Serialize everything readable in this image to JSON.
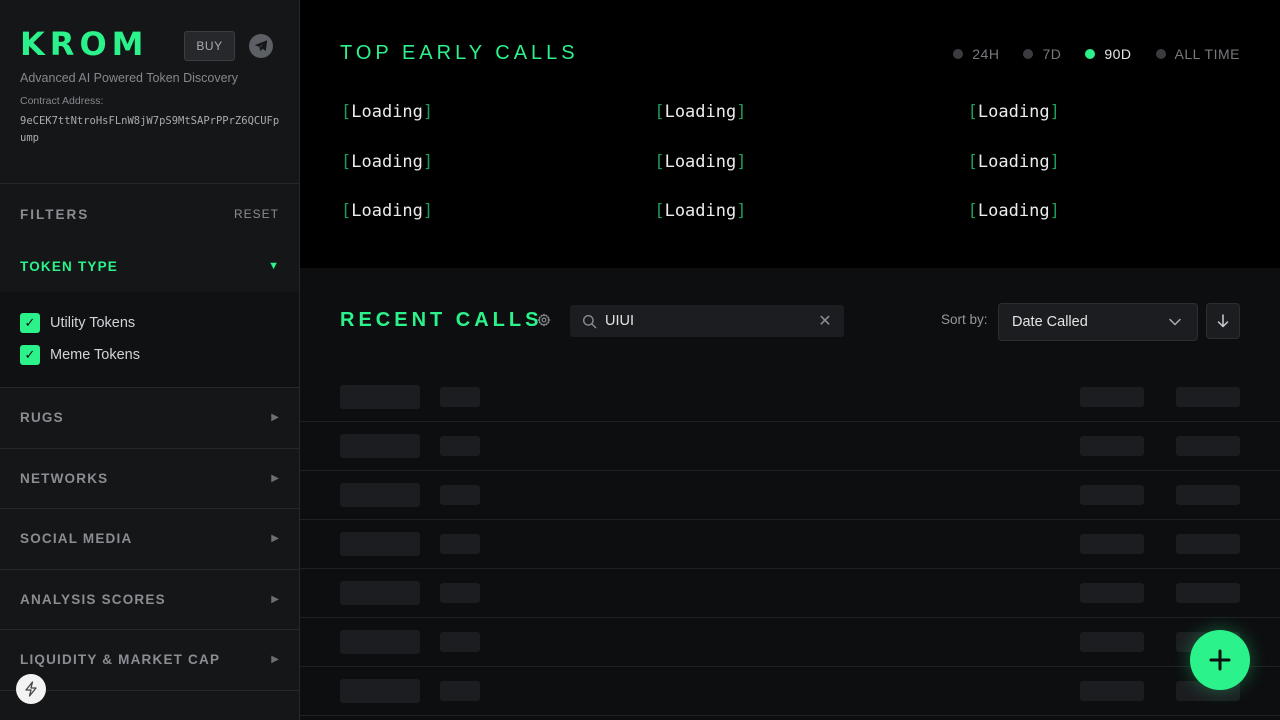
{
  "brand": {
    "logo": "KROM",
    "buy_label": "BUY",
    "tagline": "Advanced AI Powered Token Discovery",
    "contract_label": "Contract Address:",
    "contract_value": "9eCEK7ttNtroHsFLnW8jW7pS9MtSAPrPPrZ6QCUFpump"
  },
  "filters": {
    "title": "FILTERS",
    "reset_label": "RESET",
    "token_type": {
      "title": "TOKEN TYPE",
      "options": [
        {
          "label": "Utility Tokens",
          "checked": true
        },
        {
          "label": "Meme Tokens",
          "checked": true
        }
      ]
    },
    "sections": [
      "RUGS",
      "NETWORKS",
      "SOCIAL MEDIA",
      "ANALYSIS SCORES",
      "LIQUIDITY & MARKET CAP"
    ]
  },
  "top_calls": {
    "title": "TOP EARLY CALLS",
    "ranges": [
      {
        "label": "24H",
        "active": false
      },
      {
        "label": "7D",
        "active": false
      },
      {
        "label": "90D",
        "active": true
      },
      {
        "label": "ALL TIME",
        "active": false
      }
    ],
    "loading_text": "Loading",
    "loading_cells": 9
  },
  "recent_calls": {
    "title": "RECENT CALLS",
    "search_value": "UIUI",
    "sort_label": "Sort by:",
    "sort_value": "Date Called",
    "skeleton_rows": 7
  },
  "colors": {
    "accent": "#2bf28a",
    "sidebar_bg": "#151618",
    "top_panel_bg": "#000000",
    "main_bg": "#0d0e10"
  },
  "icons": {
    "telegram": "telegram-icon",
    "bolt": "lightning-bolt-icon",
    "gear": "gear-icon",
    "search": "search-icon",
    "clear": "close-icon",
    "chevron": "chevron-down-icon",
    "sort_dir": "arrow-down-icon",
    "fab": "plus-icon"
  }
}
